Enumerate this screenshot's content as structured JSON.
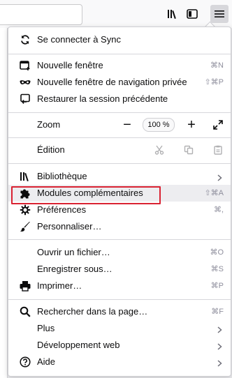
{
  "menu": {
    "sync": {
      "label": "Se connecter à Sync"
    },
    "new_window": {
      "label": "Nouvelle fenêtre",
      "shortcut": "⌘N"
    },
    "private_window": {
      "label": "Nouvelle fenêtre de navigation privée",
      "shortcut": "⇧⌘P"
    },
    "restore_session": {
      "label": "Restaurer la session précédente"
    },
    "zoom": {
      "label": "Zoom",
      "value": "100 %",
      "minus": "−",
      "plus": "+"
    },
    "edit": {
      "label": "Édition"
    },
    "library": {
      "label": "Bibliothèque"
    },
    "addons": {
      "label": "Modules complémentaires",
      "shortcut": "⇧⌘A"
    },
    "preferences": {
      "label": "Préférences",
      "shortcut": "⌘,"
    },
    "customize": {
      "label": "Personnaliser…"
    },
    "open_file": {
      "label": "Ouvrir un fichier…",
      "shortcut": "⌘O"
    },
    "save_as": {
      "label": "Enregistrer sous…",
      "shortcut": "⌘S"
    },
    "print": {
      "label": "Imprimer…",
      "shortcut": "⌘P"
    },
    "find": {
      "label": "Rechercher dans la page…",
      "shortcut": "⌘F"
    },
    "more": {
      "label": "Plus"
    },
    "web_dev": {
      "label": "Développement web"
    },
    "help": {
      "label": "Aide"
    }
  },
  "colors": {
    "highlight_box": "#d92232",
    "shortcut": "#8f8f9d"
  }
}
